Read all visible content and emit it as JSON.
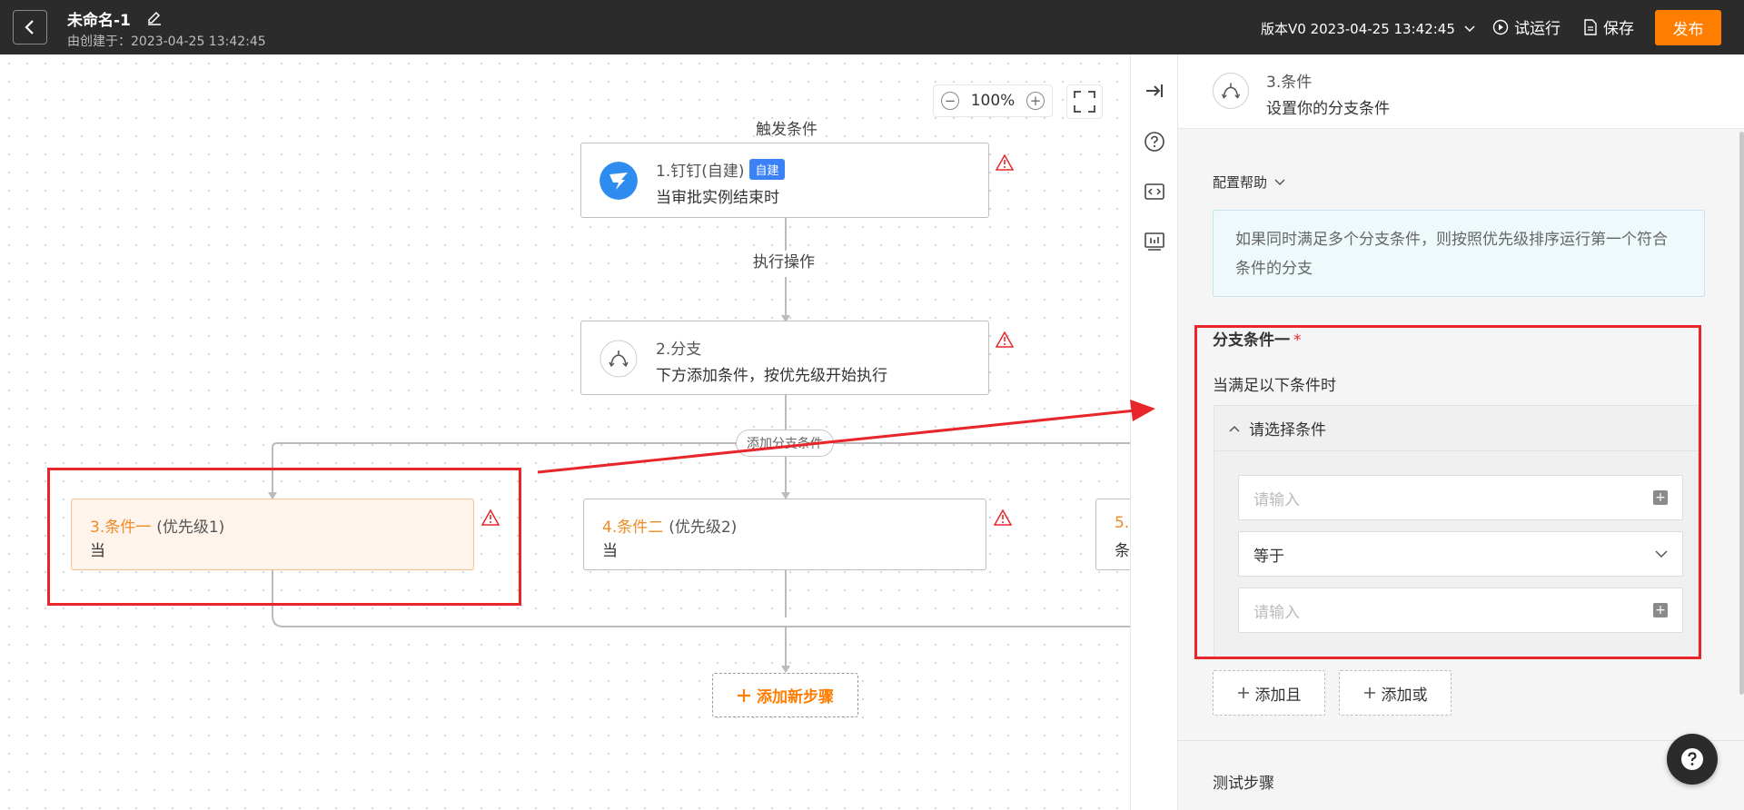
{
  "header": {
    "title": "未命名-1",
    "created_at": "由创建于：2023-04-25 13:42:45",
    "version": "版本V0 2023-04-25 13:42:45",
    "test_run_label": "试运行",
    "save_label": "保存",
    "publish_label": "发布"
  },
  "canvas": {
    "zoom": "100%",
    "trigger_label": "触发条件",
    "action_label": "执行操作",
    "nodes": [
      {
        "title": "1.钉钉(自建)",
        "tag": "自建",
        "desc": "当审批实例结束时"
      },
      {
        "title": "2.分支",
        "desc": "下方添加条件，按优先级开始执行"
      }
    ],
    "conditions": [
      {
        "num": "3.条件一",
        "priority": "(优先级1)",
        "desc": "当"
      },
      {
        "num": "4.条件二",
        "priority": "(优先级2)",
        "desc": "当"
      },
      {
        "num": "5.",
        "desc": "条"
      }
    ],
    "add_branch_label": "添加分支条件",
    "add_step_label": "添加新步骤"
  },
  "panel": {
    "title": "3.条件",
    "subtitle": "设置你的分支条件",
    "config_help": "配置帮助",
    "info": "如果同时满足多个分支条件，则按照优先级排序运行第一个符合条件的分支",
    "section_title": "分支条件一",
    "required_mark": "*",
    "condition_sub": "当满足以下条件时",
    "select_condition": "请选择条件",
    "input1_placeholder": "请输入",
    "operator": "等于",
    "input2_placeholder": "请输入",
    "add_and": "添加且",
    "add_or": "添加或",
    "test_step": "测试步骤"
  },
  "colors": {
    "accent": "#ff7d00",
    "highlight": "#e8262a",
    "tag": "#3b82f6"
  }
}
